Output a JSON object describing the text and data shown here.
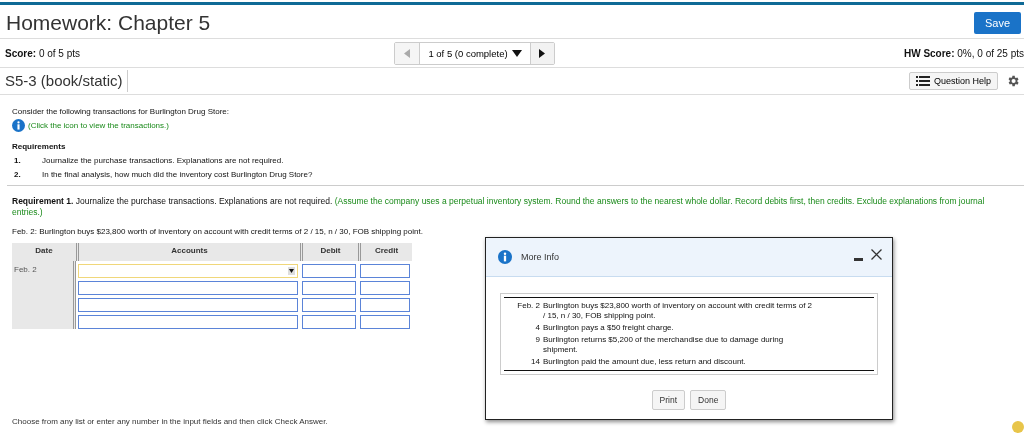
{
  "header": {
    "title": "Homework: Chapter 5",
    "save_button": "Save"
  },
  "score_bar": {
    "score_label": "Score:",
    "score_value": "0 of 5 pts",
    "pager": "1 of 5 (0 complete)",
    "hw_score_label": "HW Score:",
    "hw_score_value": "0%, 0 of 25 pts"
  },
  "question_bar": {
    "title": "S5-3 (book/static)",
    "help_button": "Question Help"
  },
  "question": {
    "intro": "Consider the following transactions for Burlington Drug Store:",
    "info_link": "(Click the icon to view the transactions.)",
    "requirements_heading": "Requirements",
    "requirements": [
      {
        "number": "1.",
        "text": "Journalize the purchase transactions. Explanations are not required."
      },
      {
        "number": "2.",
        "text": "In the final analysis, how much did the inventory cost Burlington Drug Store?"
      }
    ],
    "requirement_1": "**Requirement 1.** Journalize the purchase transactions. Explanations are not required.",
    "instructions": "(Assume the company uses a perpetual inventory system. Round the answers to the nearest whole dollar. Record debits first, then credits. Exclude explanations from journal entries.)",
    "transaction": "Feb. 2: Burlington buys $23,800 worth of inventory on account with credit terms of 2 / 15, n / 30, FOB shipping point."
  },
  "journal": {
    "columns": [
      "Date",
      "Accounts",
      "Debit",
      "Credit"
    ],
    "date": "Feb. 2",
    "rows": [
      {
        "kind": "dropdown",
        "focused": true
      },
      {
        "kind": "text",
        "focused": false
      },
      {
        "kind": "text",
        "focused": false
      },
      {
        "kind": "text",
        "focused": false
      }
    ]
  },
  "footer_hint": "Choose from any list or enter any number in the input fields and then click Check Answer.",
  "modal": {
    "title": "More Info",
    "transactions": [
      {
        "date": "Feb. 2",
        "text": "Burlington buys $23,800 worth of inventory on account with credit terms of 2 / 15, n / 30, FOB shipping point."
      },
      {
        "date": "4",
        "text": "Burlington pays a $50 freight charge."
      },
      {
        "date": "9",
        "text": "Burlington returns $5,200 of the merchandise due to damage during shipment."
      },
      {
        "date": "14",
        "text": "Burlington paid the amount due, less return and discount."
      }
    ],
    "buttons": [
      "Print",
      "Done"
    ]
  }
}
